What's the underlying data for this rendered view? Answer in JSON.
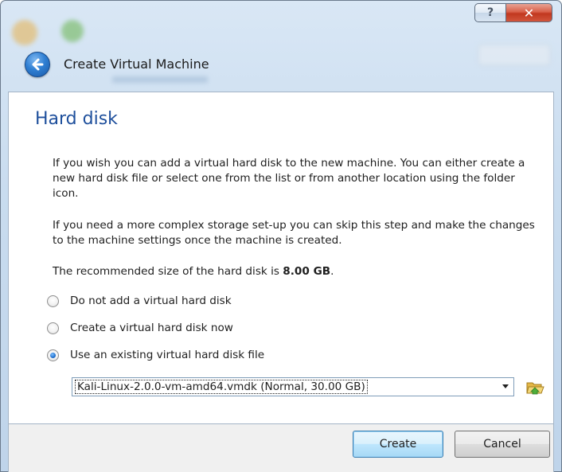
{
  "window": {
    "help_button": "?",
    "close_button": "✕"
  },
  "header": {
    "title": "Create Virtual Machine"
  },
  "page": {
    "title": "Hard disk",
    "paragraph1": "If you wish you can add a virtual hard disk to the new machine. You can either create a new hard disk file or select one from the list or from another location using the folder icon.",
    "paragraph2": "If you need a more complex storage set-up you can skip this step and make the changes to the machine settings once the machine is created.",
    "recommended_prefix": "The recommended size of the hard disk is ",
    "recommended_size": "8.00 GB",
    "recommended_suffix": "."
  },
  "options": [
    {
      "label": "Do not add a virtual hard disk",
      "checked": false
    },
    {
      "label": "Create a virtual hard disk now",
      "checked": false
    },
    {
      "label": "Use an existing virtual hard disk file",
      "checked": true
    }
  ],
  "disk_select": {
    "selected": "Kali-Linux-2.0.0-vm-amd64.vmdk (Normal, 30.00 GB)"
  },
  "buttons": {
    "create": "Create",
    "cancel": "Cancel"
  },
  "colors": {
    "title_blue": "#1e4f9c",
    "close_red": "#c1381f",
    "default_button_border": "#3c7fb1"
  },
  "icons": {
    "back": "back-arrow-icon",
    "folder": "folder-open-icon",
    "help": "help-icon",
    "close": "close-icon"
  }
}
